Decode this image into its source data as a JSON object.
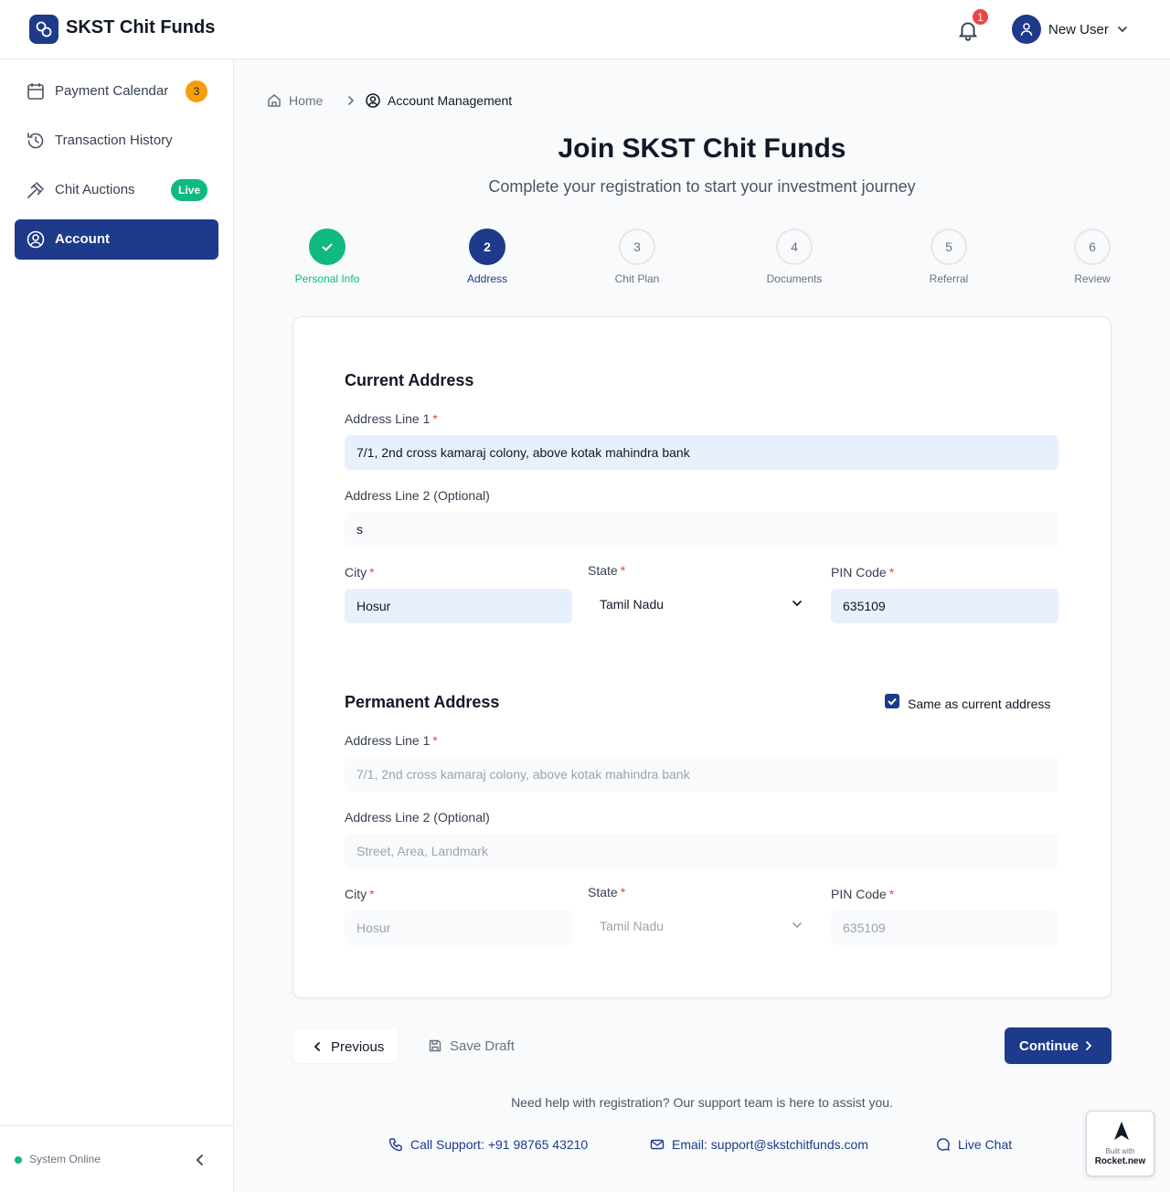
{
  "app": {
    "title": "SKST Chit Funds"
  },
  "header": {
    "notification_count": "1",
    "user_name": "New User"
  },
  "sidebar": {
    "items": [
      {
        "label": "Payment Calendar",
        "badge": "3"
      },
      {
        "label": "Transaction History"
      },
      {
        "label": "Chit Auctions",
        "badge": "Live"
      },
      {
        "label": "Account"
      }
    ],
    "status": "System Online"
  },
  "breadcrumb": {
    "home": "Home",
    "current": "Account Management"
  },
  "page": {
    "title": "Join SKST Chit Funds",
    "subtitle": "Complete your registration to start your investment journey"
  },
  "steps": [
    {
      "number": "1",
      "label": "Personal Info",
      "state": "done"
    },
    {
      "number": "2",
      "label": "Address",
      "state": "current"
    },
    {
      "number": "3",
      "label": "Chit Plan",
      "state": "pending"
    },
    {
      "number": "4",
      "label": "Documents",
      "state": "pending"
    },
    {
      "number": "5",
      "label": "Referral",
      "state": "pending"
    },
    {
      "number": "6",
      "label": "Review",
      "state": "pending"
    }
  ],
  "current_address": {
    "title": "Current Address",
    "line1_label": "Address Line 1",
    "line1_value": "7/1, 2nd cross kamaraj colony, above kotak mahindra bank",
    "line2_label": "Address Line 2 (Optional)",
    "line2_value": "s",
    "city_label": "City",
    "city_value": "Hosur",
    "state_label": "State",
    "state_value": "Tamil Nadu",
    "pin_label": "PIN Code",
    "pin_value": "635109"
  },
  "permanent_address": {
    "title": "Permanent Address",
    "same_as_label": "Same as current address",
    "same_as_checked": true,
    "line1_label": "Address Line 1",
    "line1_value": "7/1, 2nd cross kamaraj colony, above kotak mahindra bank",
    "line2_label": "Address Line 2 (Optional)",
    "line2_placeholder": "Street, Area, Landmark",
    "city_label": "City",
    "city_value": "Hosur",
    "state_label": "State",
    "state_value": "Tamil Nadu",
    "pin_label": "PIN Code",
    "pin_value": "635109"
  },
  "actions": {
    "previous": "Previous",
    "save_draft": "Save Draft",
    "continue": "Continue"
  },
  "help": {
    "text": "Need help with registration? Our support team is here to assist you.",
    "call": "Call Support: +91 98765 43210",
    "email": "Email: support@skstchitfunds.com",
    "chat": "Live Chat"
  },
  "badge": {
    "line1": "Built with",
    "line2": "Rocket.new"
  },
  "colors": {
    "primary": "#1e3a8a",
    "success": "#10b981",
    "warning": "#f59e0b",
    "danger": "#ef4444"
  }
}
